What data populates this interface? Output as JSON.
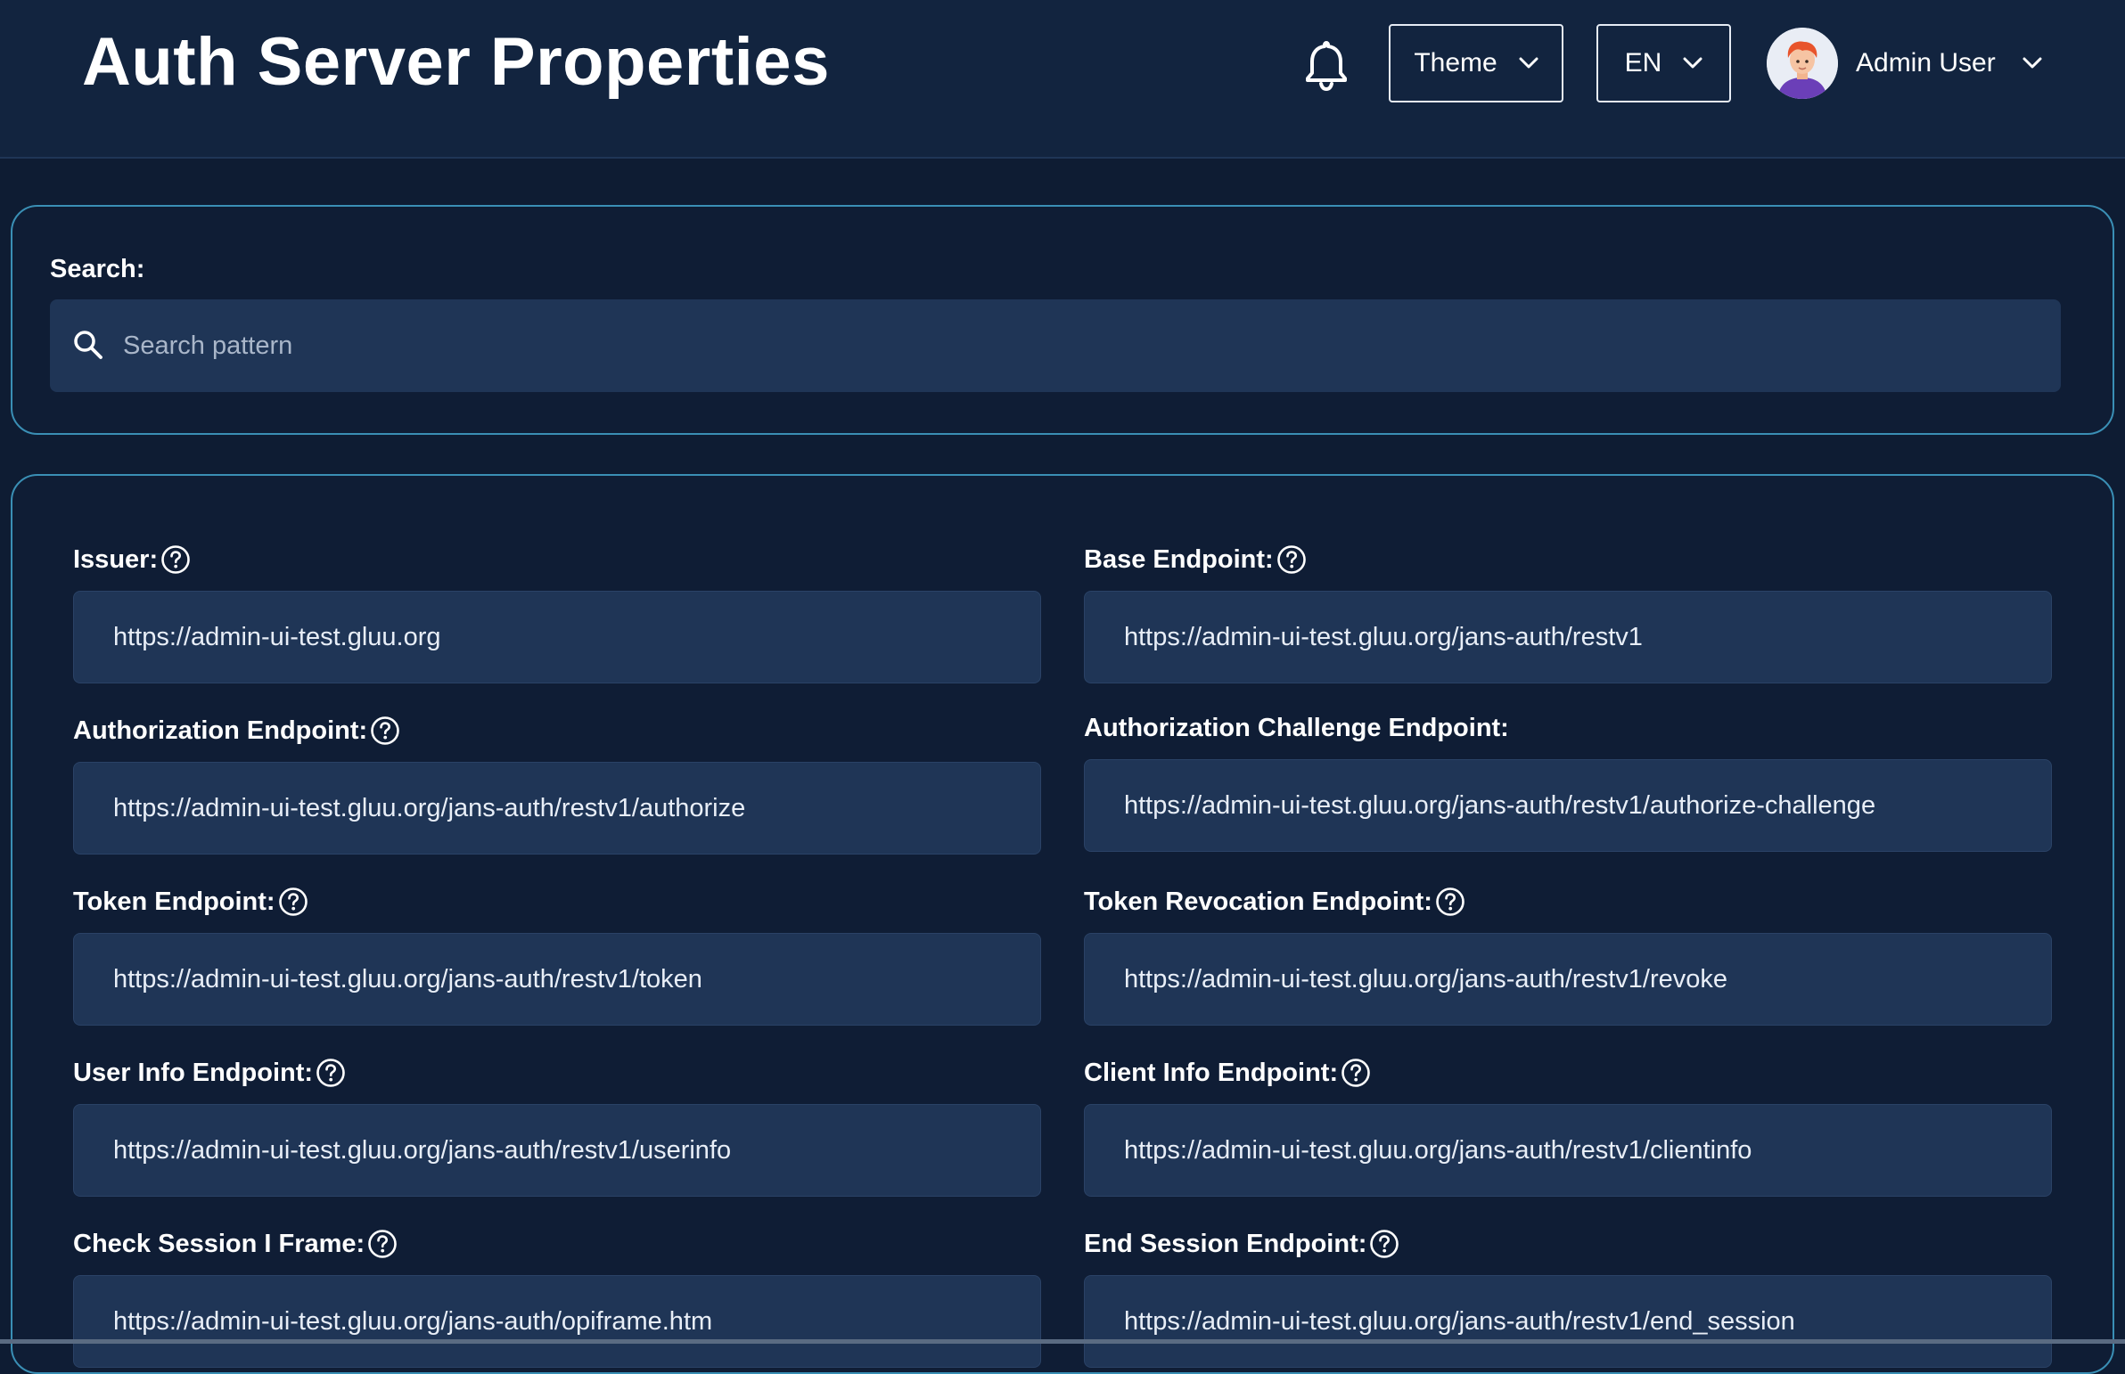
{
  "header": {
    "title": "Auth Server Properties",
    "theme_label": "Theme",
    "lang_label": "EN",
    "user_name": "Admin User"
  },
  "search": {
    "label": "Search:",
    "placeholder": "Search pattern",
    "value": ""
  },
  "properties": [
    {
      "label": "Issuer:",
      "value": "https://admin-ui-test.gluu.org",
      "help": true
    },
    {
      "label": "Base Endpoint:",
      "value": "https://admin-ui-test.gluu.org/jans-auth/restv1",
      "help": true
    },
    {
      "label": "Authorization Endpoint:",
      "value": "https://admin-ui-test.gluu.org/jans-auth/restv1/authorize",
      "help": true
    },
    {
      "label": "Authorization Challenge Endpoint:",
      "value": "https://admin-ui-test.gluu.org/jans-auth/restv1/authorize-challenge",
      "help": false
    },
    {
      "label": "Token Endpoint:",
      "value": "https://admin-ui-test.gluu.org/jans-auth/restv1/token",
      "help": true
    },
    {
      "label": "Token Revocation Endpoint:",
      "value": "https://admin-ui-test.gluu.org/jans-auth/restv1/revoke",
      "help": true
    },
    {
      "label": "User Info Endpoint:",
      "value": "https://admin-ui-test.gluu.org/jans-auth/restv1/userinfo",
      "help": true
    },
    {
      "label": "Client Info Endpoint:",
      "value": "https://admin-ui-test.gluu.org/jans-auth/restv1/clientinfo",
      "help": true
    },
    {
      "label": "Check Session I Frame:",
      "value": "https://admin-ui-test.gluu.org/jans-auth/opiframe.htm",
      "help": true
    },
    {
      "label": "End Session Endpoint:",
      "value": "https://admin-ui-test.gluu.org/jans-auth/restv1/end_session",
      "help": true
    }
  ],
  "colors": {
    "background": "#0e1c33",
    "header": "#12243f",
    "card_border": "#3a8fb5",
    "input_bg": "#1f3556"
  },
  "icons": {
    "notifications": "bell-icon",
    "dropdown": "chevron-down-icon",
    "search": "search-icon",
    "help": "help-circle-icon",
    "avatar": "user-avatar-icon"
  }
}
